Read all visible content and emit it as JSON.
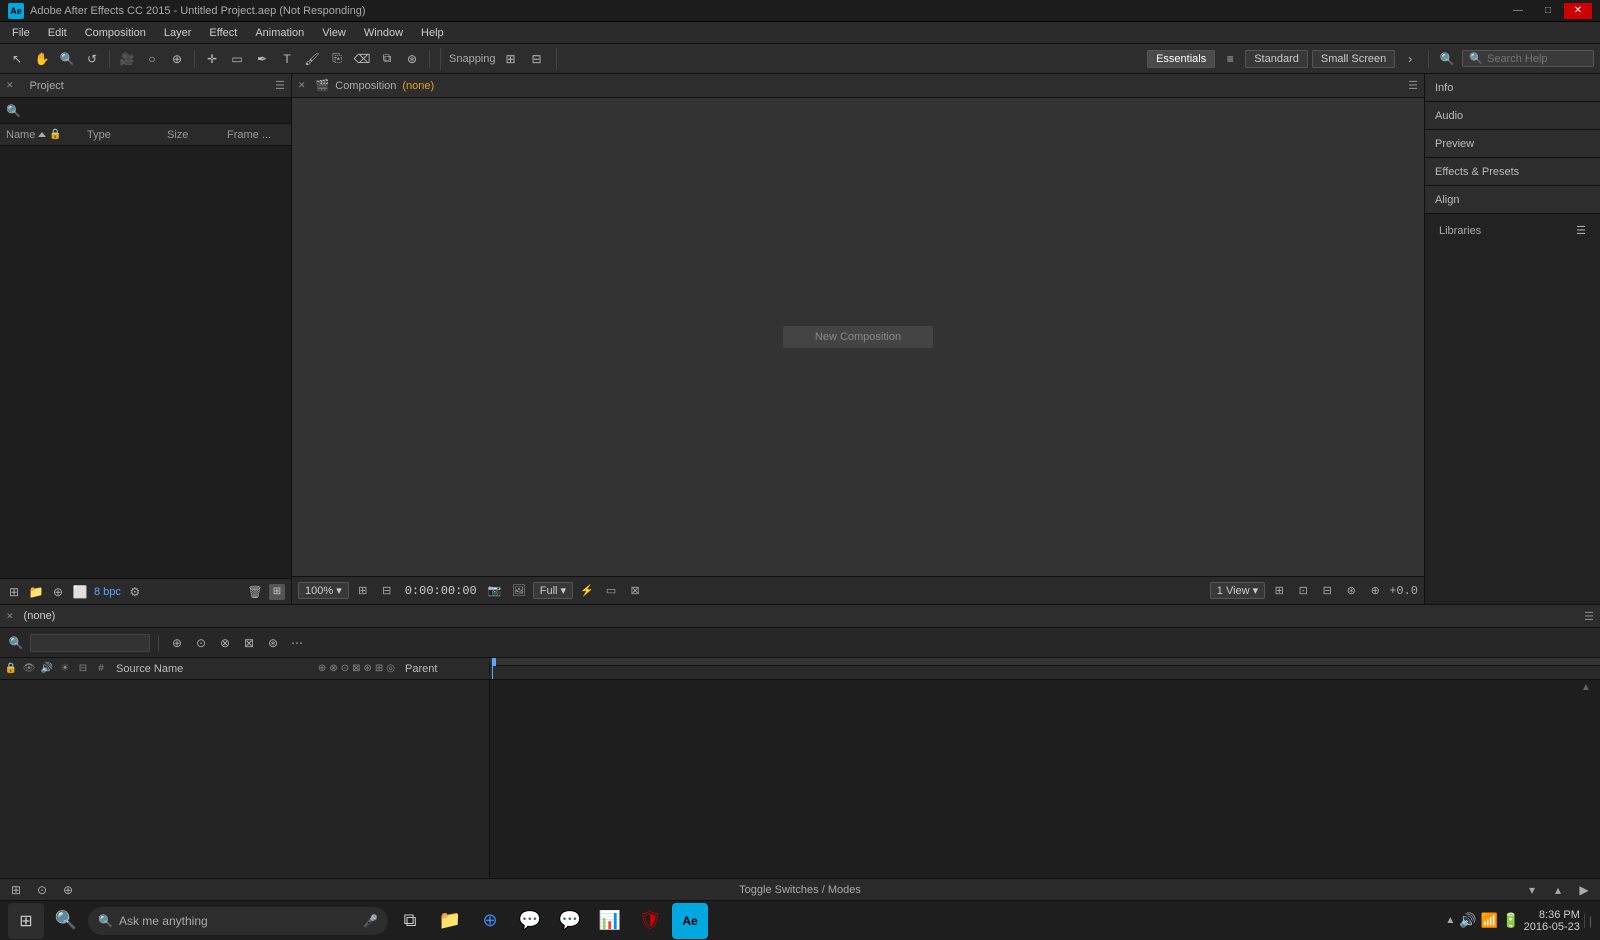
{
  "titlebar": {
    "app_name": "Adobe After Effects CC 2015 - Untitled Project.aep (Not Responding)",
    "icon_label": "Ae",
    "minimize": "—",
    "restore": "□",
    "close": "✕"
  },
  "menubar": {
    "items": [
      "File",
      "Edit",
      "Composition",
      "Layer",
      "Effect",
      "Animation",
      "View",
      "Window",
      "Help"
    ]
  },
  "toolbar": {
    "snapping_label": "Snapping",
    "workspaces": [
      "Essentials",
      "Standard",
      "Small Screen"
    ],
    "search_placeholder": "Search Help",
    "active_workspace": "Essentials"
  },
  "project_panel": {
    "title": "Project",
    "search_placeholder": "",
    "columns": [
      "Name",
      "Type",
      "Size",
      "Frame ..."
    ],
    "bpc": "8 bpc"
  },
  "composition_panel": {
    "title": "Composition",
    "comp_name": "(none)",
    "zoom": "100%",
    "timecode": "0:00:00:00",
    "quality": "Full",
    "views": "1 View",
    "offset": "+0.0",
    "placeholder_text": "New Composition"
  },
  "right_panel": {
    "items": [
      "Info",
      "Audio",
      "Preview",
      "Effects & Presets",
      "Align",
      "Libraries"
    ]
  },
  "timeline_panel": {
    "comp_name": "(none)",
    "source_name": "Source Name",
    "parent_label": "Parent",
    "toggle_label": "Toggle Switches / Modes"
  }
}
